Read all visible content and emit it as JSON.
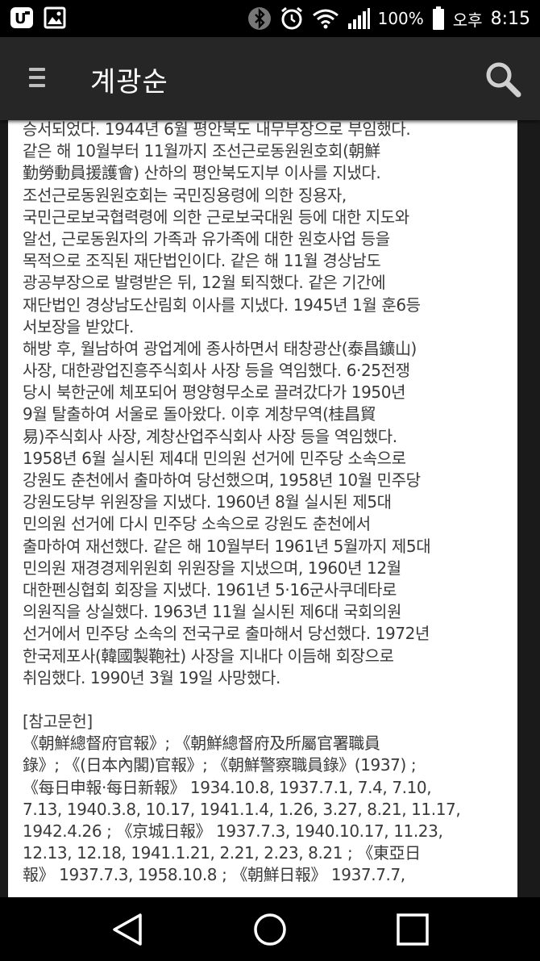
{
  "status_bar": {
    "battery": "100%",
    "ampm": "오후",
    "time": "8:15"
  },
  "app_bar": {
    "title": "계광순",
    "icons": [
      "menu-icon",
      "search-icon"
    ]
  },
  "content": {
    "lines": [
      "승서되었다. 1944년 6월 평안북도 내무부장으로 부임했다.",
      "같은 해 10월부터 11월까지 조선근로동원원호회(朝鮮",
      "勤勞動員援護會) 산하의 평안북도지부 이사를 지냈다.",
      "조선근로동원원호회는 국민징용령에 의한 징용자,",
      "국민근로보국협력령에 의한 근로보국대원 등에 대한 지도와",
      "알선, 근로동원자의 가족과 유가족에 대한 원호사업 등을",
      "목적으로 조직된 재단법인이다. 같은 해 11월 경상남도",
      "광공부장으로 발령받은 뒤, 12월 퇴직했다. 같은 기간에",
      "재단법인 경상남도산림회 이사를 지냈다. 1945년 1월 훈6등",
      "서보장을 받았다.",
      "해방 후, 월남하여 광업계에 종사하면서 태창광산(泰昌鑛山)",
      "사장, 대한광업진흥주식회사 사장 등을 역임했다. 6·25전쟁",
      "당시 북한군에 체포되어 평양형무소로 끌려갔다가 1950년",
      "9월 탈출하여 서울로 돌아왔다. 이후 계창무역(桂昌貿",
      "易)주식회사 사장, 계창산업주식회사 사장 등을 역임했다.",
      "1958년 6월 실시된 제4대 민의원 선거에 민주당 소속으로",
      "강원도 춘천에서 출마하여 당선했으며, 1958년 10월 민주당",
      "강원도당부 위원장을 지냈다. 1960년 8월 실시된 제5대",
      "민의원 선거에 다시 민주당 소속으로 강원도 춘천에서",
      "출마하여 재선했다. 같은 해 10월부터 1961년 5월까지 제5대",
      "민의원 재경경제위원회 위원장을 지냈으며, 1960년 12월",
      "대한펜싱협회 회장을 지냈다. 1961년 5·16군사쿠데타로",
      "의원직을 상실했다. 1963년 11월 실시된 제6대 국회의원",
      "선거에서 민주당 소속의 전국구로 출마해서 당선했다. 1972년",
      "한국제포사(韓國製鞄社) 사장을 지내다 이듬해 회장으로",
      "취임했다. 1990년 3월 19일 사망했다.",
      "",
      "[참고문헌]",
      "《朝鮮總督府官報》; 《朝鮮總督府及所屬官署職員",
      "錄》; 《(日本內閣)官報》; 《朝鮮警察職員錄》(1937) ;",
      "《每日申報·每日新報》 1934.10.8, 1937.7.1, 7.4, 7.10,",
      "7.13, 1940.3.8, 10.17, 1941.1.4, 1.26, 3.27, 8.21, 11.17,",
      "1942.4.26 ; 《京城日報》 1937.7.3, 1940.10.17, 11.23,",
      "12.13, 12.18, 1941.1.21, 2.21, 2.23, 8.21 ; 《東亞日",
      "報》 1937.7.3, 1958.10.8 ; 《朝鮮日報》 1937.7.7,"
    ]
  },
  "nav_bar": {
    "icons": [
      "back-icon",
      "home-icon",
      "recents-icon"
    ]
  }
}
